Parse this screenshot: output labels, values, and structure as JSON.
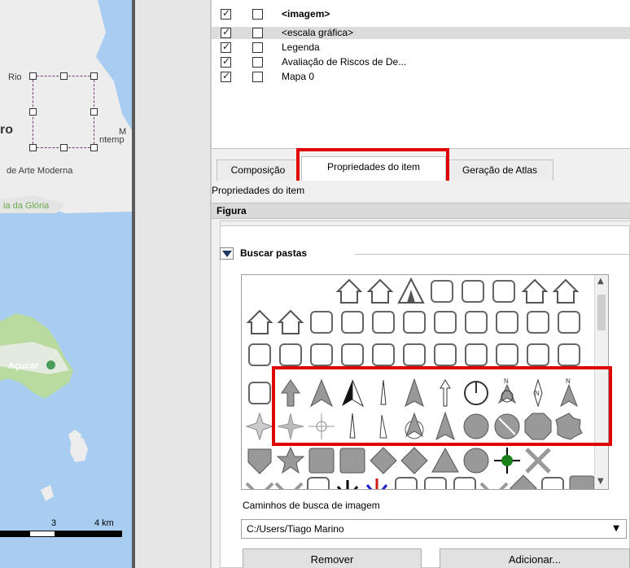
{
  "map": {
    "labels": {
      "rio": "Rio",
      "ro": "ro",
      "m": "M",
      "ntemp": "ntemp",
      "arte": "de Arte Moderna",
      "gloria": "ia da Glória",
      "acucar": "Açucar"
    },
    "scale": {
      "left": "3",
      "right": "4 km"
    },
    "colors": {
      "water": "#a8cdf0",
      "land": "#ededed",
      "park": "#b9dba0"
    }
  },
  "items": [
    {
      "label": "<imagem>",
      "visible": true,
      "locked": false,
      "bold": true,
      "highlighted": false
    },
    {
      "label": "<escala gráfica>",
      "visible": true,
      "locked": false,
      "bold": false,
      "highlighted": true
    },
    {
      "label": "Legenda",
      "visible": true,
      "locked": false,
      "bold": false,
      "highlighted": false
    },
    {
      "label": "Avaliação de Riscos de De...",
      "visible": true,
      "locked": false,
      "bold": false,
      "highlighted": false
    },
    {
      "label": "Mapa 0",
      "visible": true,
      "locked": false,
      "bold": false,
      "highlighted": false
    }
  ],
  "tabs": {
    "composicao": "Composição",
    "propriedades": "Propriedades do item",
    "atlas": "Geração de Atlas"
  },
  "panel": {
    "header": "Propriedades do item",
    "section": "Figura",
    "group_title": "Buscar pastas",
    "search_paths_label": "Caminhos de busca de imagem",
    "path_value": "C:/Users/Tiago Marino",
    "remove_label": "Remover",
    "add_label": "Adicionar..."
  },
  "icons": {
    "row1": [
      "shelter-icon",
      "house-bb-icon",
      "tent-icon",
      "caravan-icon",
      "hotel-bed-icon",
      "bed-icon",
      "house-icon",
      "weather-shelter-icon"
    ],
    "row2": [
      "rain-shelter-icon",
      "houses-icon",
      "bench-icon",
      "scales-icon",
      "fire-icon",
      "fire-emblem-icon",
      "fire-ban-icon",
      "palm-icon",
      "info-icon",
      "book-icon",
      "handcuffs-icon"
    ],
    "row3": [
      "police-badge-icon",
      "mail-icon",
      "mail-circle-icon",
      "phone-booth-icon",
      "recycle-icon",
      "tripod-icon",
      "telephone-icon",
      "family-icon",
      "wheelchair-wc-icon",
      "wc-men-icon",
      "wc-women-icon"
    ],
    "row4": [
      "person-bin-icon",
      "arrow-up-icon",
      "north-arrow-icon",
      "north-arrow-half-icon",
      "north-needle-icon",
      "north-arrow-tall-icon",
      "arrow-thin-icon",
      "north-circle-icon",
      "north-n-icon",
      "compass-n-icon",
      "north-spike-icon"
    ],
    "row5": [
      "compass-rose-icon",
      "star-compass-icon",
      "crosshair-icon",
      "needle-icon",
      "needle-alt-icon",
      "arrow-circle-icon",
      "arrow-circle-alt-icon",
      "circle-icon",
      "circle-slash-icon",
      "octagon-icon",
      "badge-icon"
    ],
    "row6": [
      "shield-icon",
      "star-badge-icon",
      "square-icon",
      "square-alt-icon",
      "diamond-icon",
      "diamond-alt-icon",
      "triangle-icon",
      "circle-crosshair-icon",
      "cross-target-icon",
      "x-cross-icon"
    ],
    "row7": [
      "chevron-icon",
      "chevron-alt-icon",
      "arrow-down-icon",
      "black-arrow-icon",
      "color-arrow-icon",
      "grass-icon",
      "plus-icon",
      "minus-icon",
      "chevron-wide-icon",
      "diamond-small-icon",
      "bone-icon",
      "square-small-icon"
    ]
  }
}
